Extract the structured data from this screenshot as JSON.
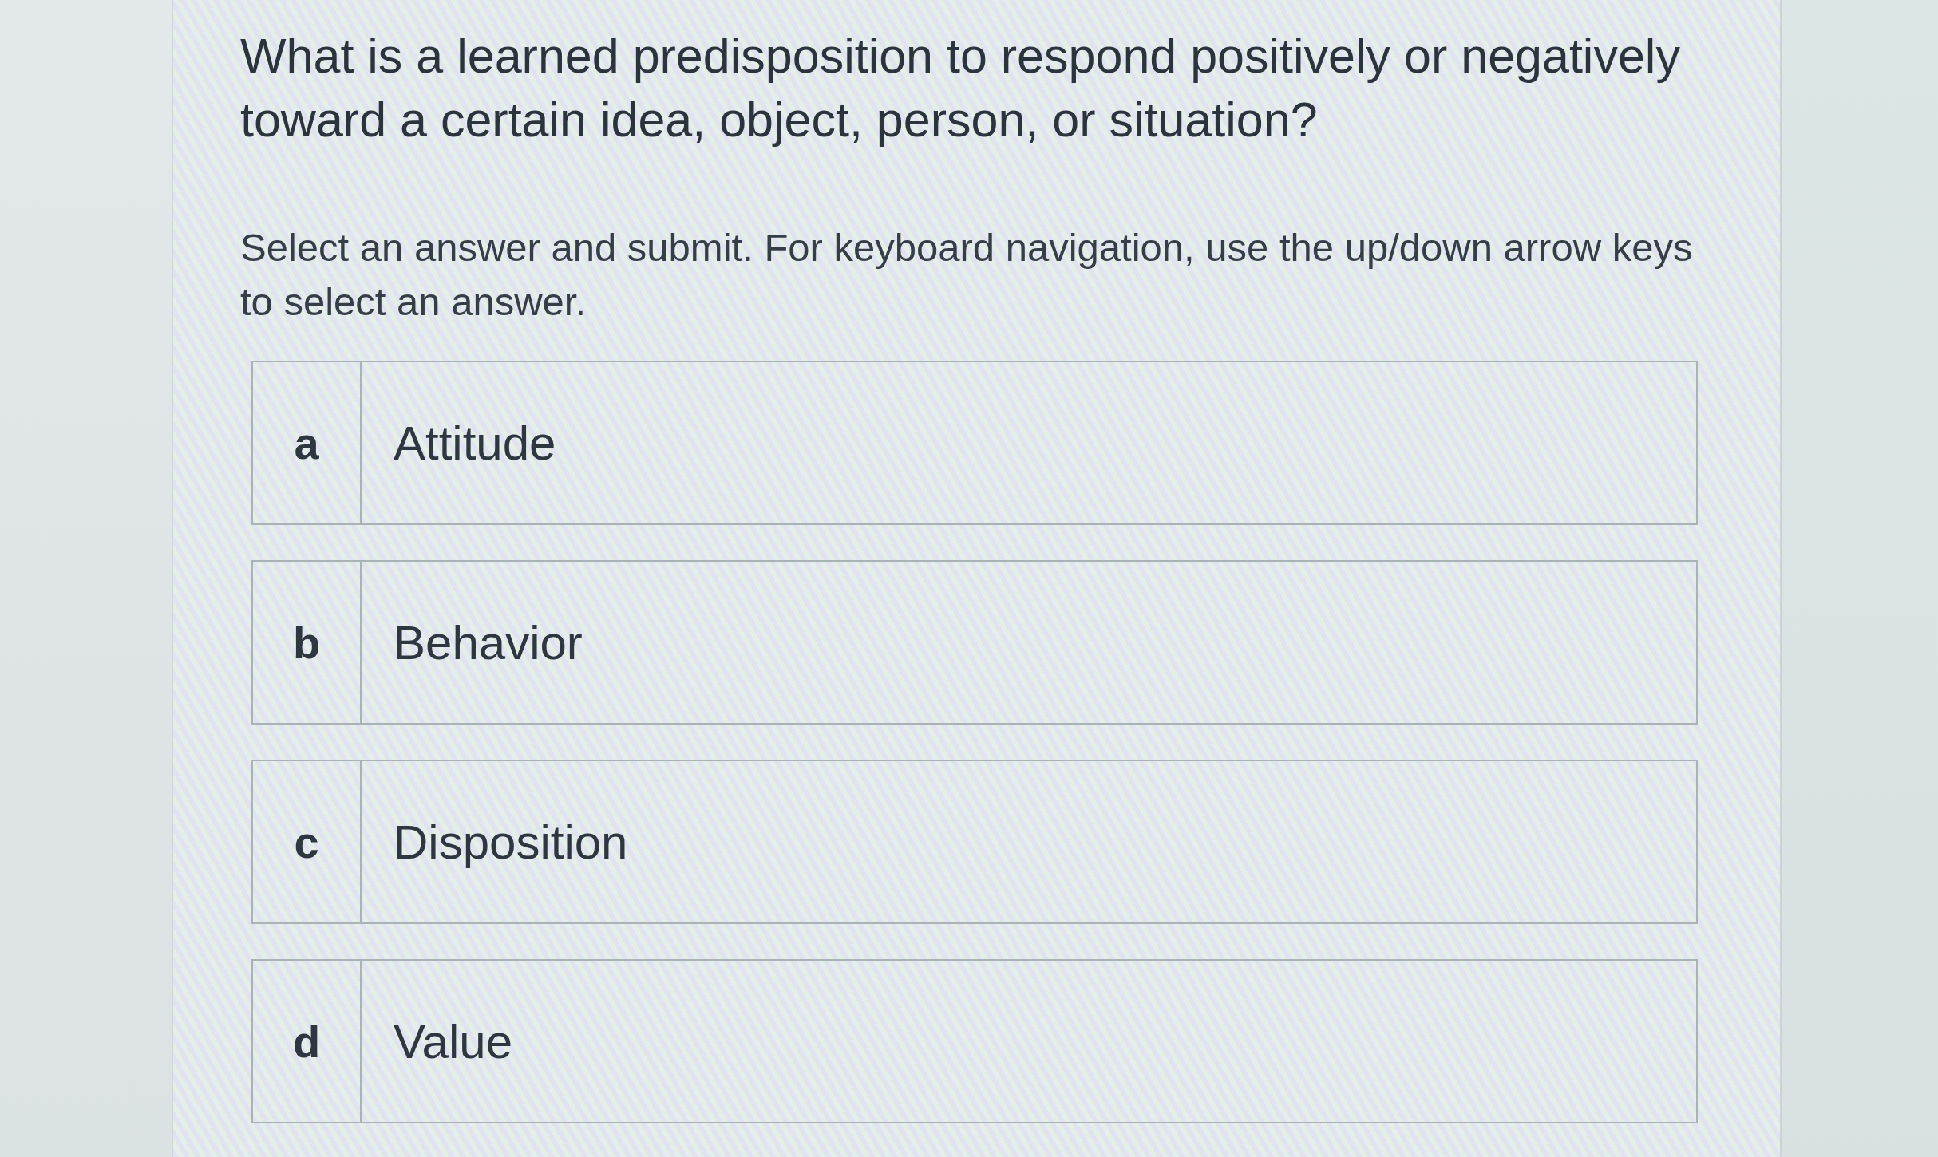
{
  "question": {
    "text": "What is a learned predisposition to respond positively or negatively toward a certain idea, object, person, or situation?"
  },
  "instructions": {
    "text": "Select an answer and submit. For keyboard navigation, use the up/down arrow keys to select an answer."
  },
  "options": [
    {
      "letter": "a",
      "label": "Attitude"
    },
    {
      "letter": "b",
      "label": "Behavior"
    },
    {
      "letter": "c",
      "label": "Disposition"
    },
    {
      "letter": "d",
      "label": "Value"
    }
  ]
}
